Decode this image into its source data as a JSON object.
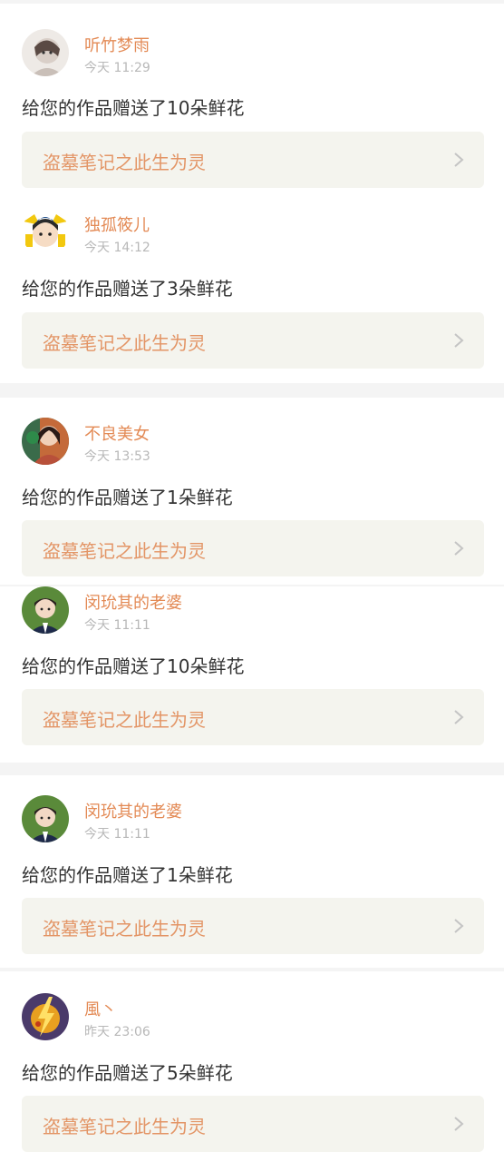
{
  "notifications": [
    {
      "user": "听竹梦雨",
      "time": "今天 11:29",
      "message": "给您的作品赠送了10朵鲜花",
      "work": "盗墓笔记之此生为灵",
      "avatar_icon": "anime-girl-avatar-icon",
      "avatar_color": "#d9cfc8"
    },
    {
      "user": "独孤筱儿",
      "time": "今天 14:12",
      "message": "给您的作品赠送了3朵鲜花",
      "work": "盗墓笔记之此生为灵",
      "avatar_icon": "cartoon-face-avatar-icon",
      "avatar_color": "#f2c80f"
    },
    {
      "user": "不良美女",
      "time": "今天 13:53",
      "message": "给您的作品赠送了1朵鲜花",
      "work": "盗墓笔记之此生为灵",
      "avatar_icon": "woman-avatar-icon",
      "avatar_color": "#b8503a"
    },
    {
      "user": "闵玧其的老婆",
      "time": "今天 11:11",
      "message": "给您的作品赠送了10朵鲜花",
      "work": "盗墓笔记之此生为灵",
      "avatar_icon": "man-avatar-icon",
      "avatar_color": "#5a8a3a"
    },
    {
      "user": "闵玧其的老婆",
      "time": "今天 11:11",
      "message": "给您的作品赠送了1朵鲜花",
      "work": "盗墓笔记之此生为灵",
      "avatar_icon": "man-avatar-icon",
      "avatar_color": "#5a8a3a"
    },
    {
      "user": "風丶",
      "time": "昨天 23:06",
      "message": "给您的作品赠送了5朵鲜花",
      "work": "盗墓笔记之此生为灵",
      "avatar_icon": "lightning-avatar-icon",
      "avatar_color": "#4a3a6a"
    }
  ],
  "colors": {
    "username": "#e38a55",
    "work_title": "#e39566",
    "work_link_bg": "#f4f4ee",
    "timestamp": "#b8b8b8",
    "message": "#333333"
  }
}
